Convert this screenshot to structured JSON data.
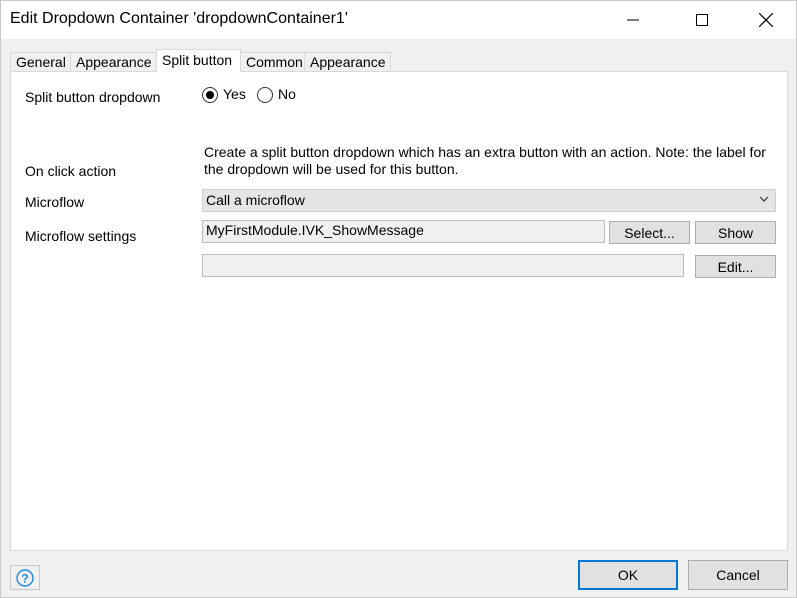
{
  "window": {
    "title": "Edit Dropdown Container 'dropdownContainer1'",
    "controls": [
      "minimize-icon",
      "maximize-icon",
      "close-icon"
    ]
  },
  "tabs": [
    {
      "label": "General",
      "active": false
    },
    {
      "label": "Appearance",
      "active": false
    },
    {
      "label": "Split button",
      "active": true
    },
    {
      "label": "Common",
      "active": false
    },
    {
      "label": "Appearance",
      "active": false
    }
  ],
  "form": {
    "split_label": "Split button dropdown",
    "radio_yes": "Yes",
    "radio_no": "No",
    "selected": "Yes",
    "description": "Create a split button dropdown which has an extra button with an action. Note: the label for the dropdown will be used for this button.",
    "on_click_label": "On click action",
    "on_click_value": "Call a microflow",
    "microflow_label": "Microflow",
    "microflow_value": "MyFirstModule.IVK_ShowMessage",
    "select_button": "Select...",
    "show_button": "Show",
    "settings_label": "Microflow settings",
    "settings_value": "",
    "edit_button": "Edit..."
  },
  "footer": {
    "help_icon": "help-icon",
    "ok": "OK",
    "cancel": "Cancel"
  },
  "colors": {
    "accent": "#0078d7",
    "help": "#1e88e5"
  }
}
